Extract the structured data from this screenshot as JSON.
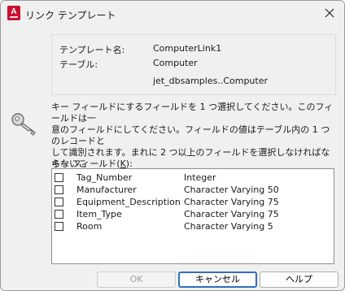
{
  "window": {
    "title": "リンク テンプレート",
    "close_glyph": "✕",
    "app_icon_letter": "A"
  },
  "info": {
    "template_name_label": "テンプレート名:",
    "template_name_value": "ComputerLink1",
    "table_label": "テーブル:",
    "table_value": "Computer",
    "table_path": "jet_dbsamples..Computer"
  },
  "description": "キー フィールドにするフィールドを 1 つ選択してください。このフィールドは一\n意のフィールドにしてください。フィールドの値はテーブル内の 1 つのレコードと\nして識別されます。まれに 2 つ以上のフィールドを選択しなければならないこ\nとがあります。",
  "key_fields": {
    "label_prefix": "キー フィールド(",
    "label_accel": "K",
    "label_suffix": "):",
    "rows": [
      {
        "name": "Tag_Number",
        "type": "Integer",
        "checked": false
      },
      {
        "name": "Manufacturer",
        "type": "Character Varying  50",
        "checked": false
      },
      {
        "name": "Equipment_Description",
        "type": "Character Varying  75",
        "checked": false
      },
      {
        "name": "Item_Type",
        "type": "Character Varying  75",
        "checked": false
      },
      {
        "name": "Room",
        "type": "Character Varying  5",
        "checked": false
      }
    ]
  },
  "buttons": {
    "ok": "OK",
    "cancel": "キャンセル",
    "help": "ヘルプ"
  },
  "colors": {
    "app_icon_red": "#c8102e",
    "default_button_border": "#2f6fbd"
  },
  "icons": [
    "app-icon",
    "close-icon",
    "key-icon",
    "checkbox"
  ]
}
